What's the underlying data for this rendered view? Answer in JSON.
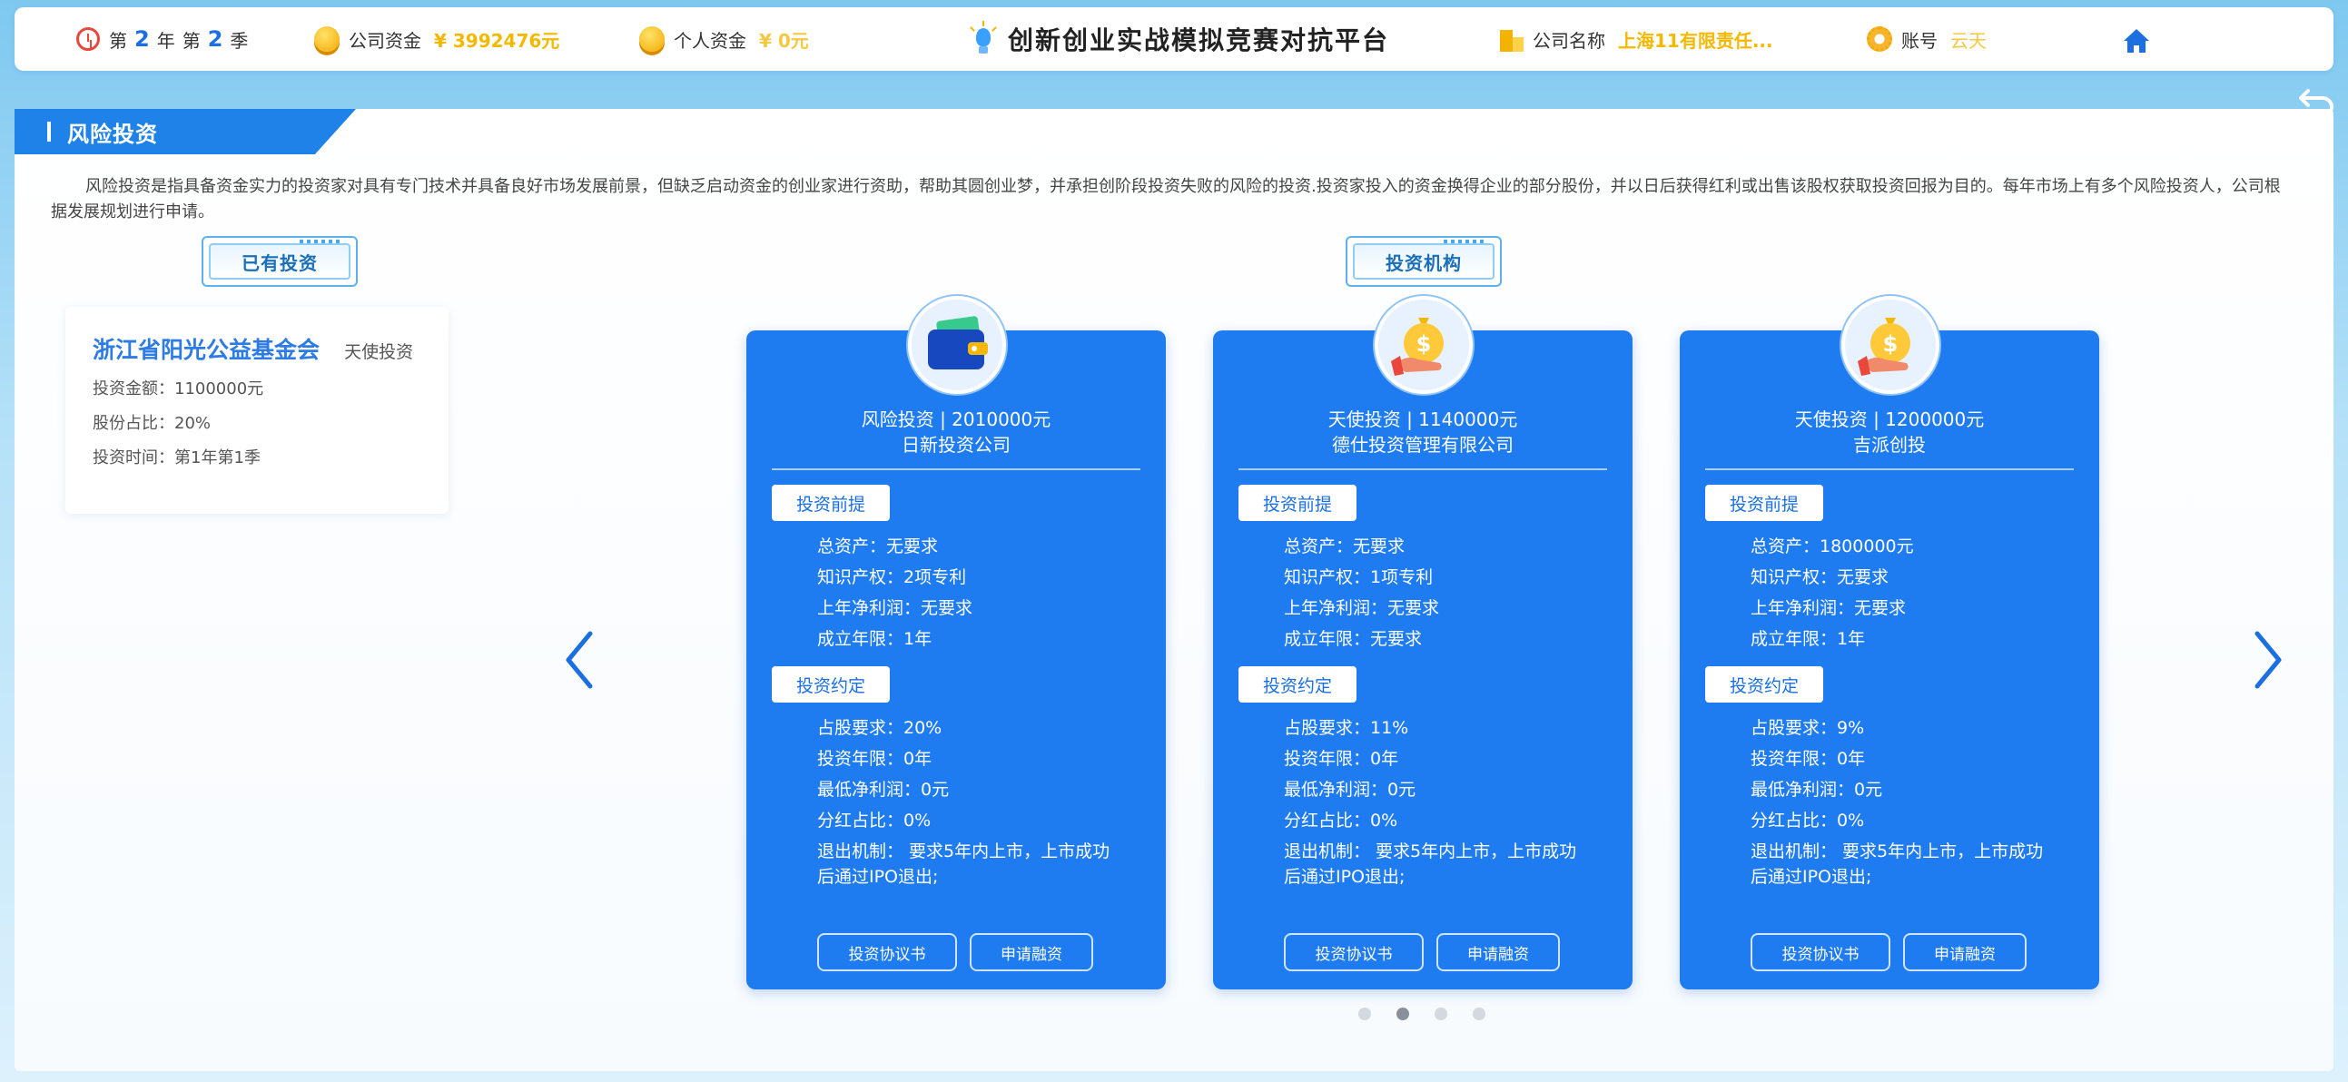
{
  "topbar": {
    "year_prefix": "第",
    "year": "2",
    "year_unit": "年",
    "season_prefix": "第",
    "season": "2",
    "season_unit": "季",
    "company_funds_label": "公司资金",
    "company_funds_value": "¥ 3992476元",
    "personal_funds_label": "个人资金",
    "personal_funds_value": "¥ 0元",
    "platform_title": "创新创业实战模拟竞赛对抗平台",
    "company_name_label": "公司名称",
    "company_name_value": "上海11有限责任...",
    "account_label": "账号",
    "account_value": "云天"
  },
  "panel": {
    "title": "风险投资",
    "description": "风险投资是指具备资金实力的投资家对具有专门技术并具备良好市场发展前景，但缺乏启动资金的创业家进行资助，帮助其圆创业梦，并承担创阶段投资失败的风险的投资.投资家投入的资金换得企业的部分股份，并以日后获得红利或出售该股权获取投资回报为目的。每年市场上有多个风险投资人，公司根据发展规划进行申请。"
  },
  "existing": {
    "section_label": "已有投资",
    "name": "浙江省阳光公益基金会",
    "type": "天使投资",
    "amount": "投资金额：1100000元",
    "share": "股份占比：20%",
    "time": "投资时间：第1年第1季"
  },
  "institutions": {
    "section_label": "投资机构",
    "cards": [
      {
        "avatar_icon": "wallet-icon",
        "headline1": "风险投资 | 2010000元",
        "headline2": "日新投资公司",
        "premise_label": "投资前提",
        "premise": [
          "总资产：无要求",
          "知识产权：2项专利",
          "上年净利润：无要求",
          "成立年限：1年"
        ],
        "terms_label": "投资约定",
        "terms": [
          "占股要求：20%",
          "投资年限：0年",
          "最低净利润：0元",
          "分红占比：0%",
          "退出机制： 要求5年内上市，上市成功后通过IPO退出;"
        ],
        "btn_agreement": "投资协议书",
        "btn_apply": "申请融资"
      },
      {
        "avatar_icon": "money-bag-hand-icon",
        "headline1": "天使投资 | 1140000元",
        "headline2": "德仕投资管理有限公司",
        "premise_label": "投资前提",
        "premise": [
          "总资产：无要求",
          "知识产权：1项专利",
          "上年净利润：无要求",
          "成立年限：无要求"
        ],
        "terms_label": "投资约定",
        "terms": [
          "占股要求：11%",
          "投资年限：0年",
          "最低净利润：0元",
          "分红占比：0%",
          "退出机制： 要求5年内上市，上市成功后通过IPO退出;"
        ],
        "btn_agreement": "投资协议书",
        "btn_apply": "申请融资"
      },
      {
        "avatar_icon": "money-bag-hand-icon",
        "headline1": "天使投资 | 1200000元",
        "headline2": "吉派创投",
        "premise_label": "投资前提",
        "premise": [
          "总资产：1800000元",
          "知识产权：无要求",
          "上年净利润：无要求",
          "成立年限：1年"
        ],
        "terms_label": "投资约定",
        "terms": [
          "占股要求：9%",
          "投资年限：0年",
          "最低净利润：0元",
          "分红占比：0%",
          "退出机制： 要求5年内上市，上市成功后通过IPO退出;"
        ],
        "btn_agreement": "投资协议书",
        "btn_apply": "申请融资"
      }
    ]
  },
  "pagination": {
    "active_page": 2,
    "total": 4
  },
  "colors": {
    "primary": "#1f7bf0",
    "accent_gold": "#f5b800",
    "header_blue": "#1e82e8"
  }
}
